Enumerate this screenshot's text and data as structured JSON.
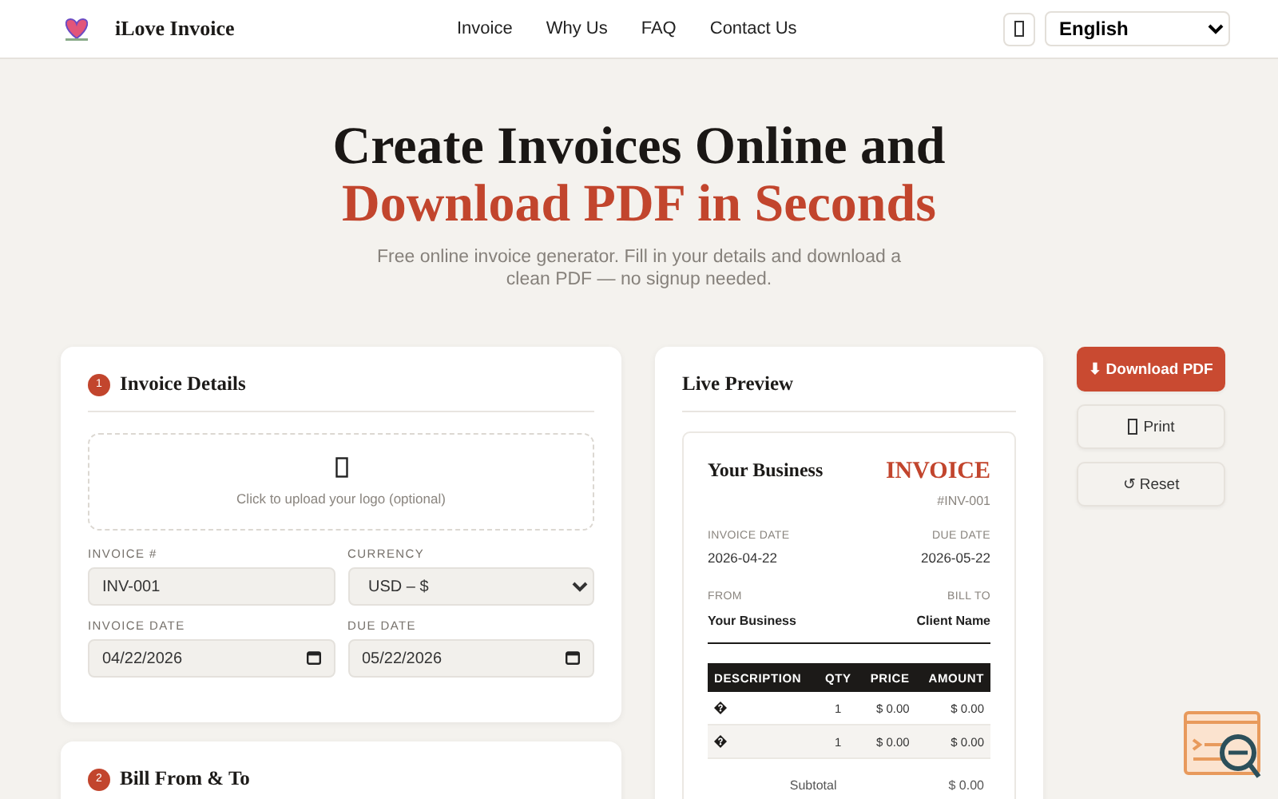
{
  "header": {
    "brand": "iLove Invoice",
    "nav": [
      "Invoice",
      "Why Us",
      "FAQ",
      "Contact Us"
    ],
    "language": "English"
  },
  "hero": {
    "title_line_1": "Create Invoices Online and",
    "title_line_2": "Download PDF in Seconds",
    "subtitle": "Free online invoice generator. Fill in your details and download a clean PDF — no signup needed."
  },
  "details_card": {
    "step": "1",
    "title": "Invoice Details",
    "upload_hint": "Click to upload your logo (optional)",
    "fields": [
      {
        "kind": "text",
        "label": "INVOICE #",
        "value": "INV-001"
      },
      {
        "kind": "select",
        "label": "CURRENCY",
        "value": "USD – $"
      },
      {
        "kind": "date",
        "label": "INVOICE DATE",
        "value": "04/22/2026"
      },
      {
        "kind": "date",
        "label": "DUE DATE",
        "value": "05/22/2026"
      }
    ]
  },
  "bill_card": {
    "step": "2",
    "title": "Bill From & To"
  },
  "preview": {
    "title": "Live Preview",
    "business": "Your Business",
    "doc_title": "INVOICE",
    "number": "#INV-001",
    "invoice_date_label": "INVOICE DATE",
    "invoice_date": "2026-04-22",
    "due_date_label": "DUE DATE",
    "due_date": "2026-05-22",
    "from_label": "FROM",
    "from": "Your Business",
    "bill_to_label": "BILL TO",
    "bill_to": "Client Name",
    "columns": [
      "DESCRIPTION",
      "QTY",
      "PRICE",
      "AMOUNT"
    ],
    "rows": [
      {
        "qty": "1",
        "price": "$ 0.00",
        "amount": "$ 0.00"
      },
      {
        "qty": "1",
        "price": "$ 0.00",
        "amount": "$ 0.00"
      }
    ],
    "subtotal_label": "Subtotal",
    "subtotal": "$ 0.00"
  },
  "actions": [
    {
      "kind": "primary",
      "label": "⬇ Download PDF"
    },
    {
      "kind": "print",
      "label": "Print"
    },
    {
      "kind": "secondary",
      "label": "↺ Reset"
    }
  ]
}
